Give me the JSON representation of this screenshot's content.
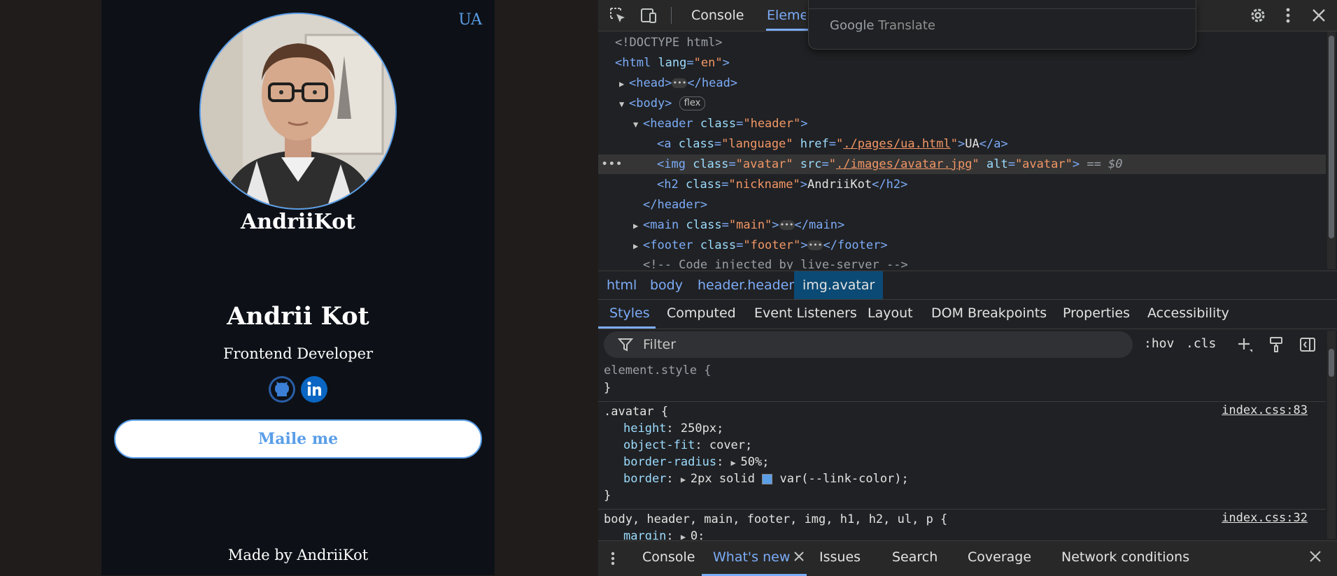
{
  "site": {
    "language_link": "UA",
    "nickname": "AndriiKot",
    "name": "Andrii Kot",
    "role": "Frontend Developer",
    "socials": [
      "github-icon",
      "linkedin-icon"
    ],
    "mail_button": "Maile me",
    "footer": "Made by AndriiKot",
    "link_color": "#5a9ee8",
    "background": "#0d1117"
  },
  "devtools": {
    "toolbar": {
      "tabs": [
        "Console",
        "Elements"
      ]
    },
    "translate_popup": {
      "brand": "Google",
      "label": "Translate"
    },
    "dom": {
      "doctype": "<!DOCTYPE html>",
      "html_open": "<html",
      "html_attr": "lang",
      "html_val": "\"en\"",
      "head_open": "<head>",
      "head_close": "</head>",
      "body_open": "<body>",
      "body_badge": "flex",
      "header_open": "<header",
      "header_class": "\"header\"",
      "a_class": "\"language\"",
      "a_href": "./pages/ua.html",
      "a_text": "UA",
      "img_class": "\"avatar\"",
      "img_src": "./images/avatar.jpg",
      "img_alt": "\"avatar\"",
      "img_marker": "== $0",
      "h2_class": "\"nickname\"",
      "h2_text": "AndriiKot",
      "header_close": "</header>",
      "main_class": "\"main\"",
      "footer_class": "\"footer\"",
      "comment": "<!-- Code injected by live-server -->"
    },
    "breadcrumbs": [
      "html",
      "body",
      "header.header",
      "img.avatar"
    ],
    "subtabs": [
      "Styles",
      "Computed",
      "Event Listeners",
      "Layout",
      "DOM Breakpoints",
      "Properties",
      "Accessibility"
    ],
    "filter_placeholder": "Filter",
    "filter_buttons": [
      ":hov",
      ".cls"
    ],
    "styles": {
      "element_style": "element.style {",
      "avatar_selector": ".avatar {",
      "avatar_source": "index.css:83",
      "height_prop": "height",
      "height_val": "250px;",
      "fit_prop": "object-fit",
      "fit_val": "cover;",
      "radius_prop": "border-radius",
      "radius_val": "50%;",
      "border_prop": "border",
      "border_val_a": "2px solid",
      "border_val_b": "var(--link-color);",
      "group_selector": "body, header, main, footer, img, h1, h2, ul, p {",
      "group_source": "index.css:32",
      "margin_prop": "margin",
      "margin_val": "0;"
    },
    "drawer": {
      "tabs": [
        "Console",
        "What's new",
        "Issues",
        "Search",
        "Coverage",
        "Network conditions"
      ]
    }
  }
}
